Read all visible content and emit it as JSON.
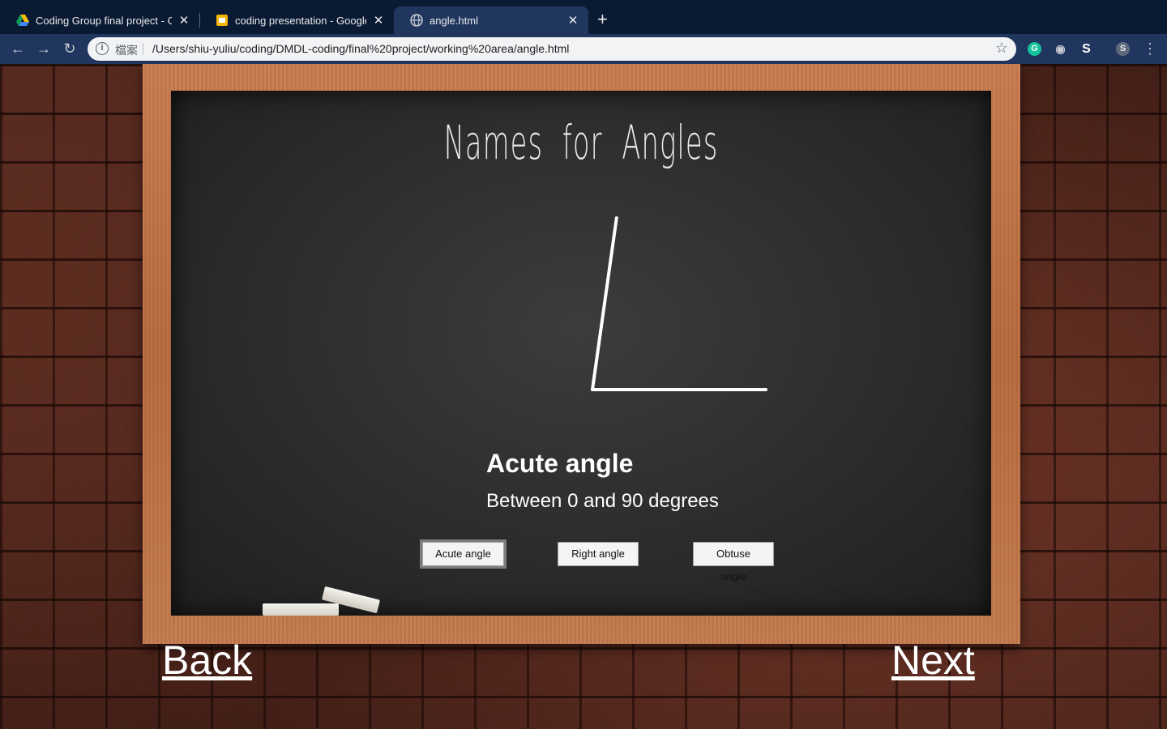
{
  "browser": {
    "tabs": [
      {
        "title": "Coding Group final project - Go",
        "favicon": "google-drive-icon"
      },
      {
        "title": "coding presentation - Google Slides",
        "favicon": "google-slides-icon"
      },
      {
        "title": "angle.html",
        "favicon": "globe-icon",
        "active": true
      }
    ],
    "scheme_label": "檔案",
    "url": "/Users/shiu-yuliu/coding/DMDL-coding/final%20project/working%20area/angle.html",
    "profile_initial": "S"
  },
  "page": {
    "title": "Names  for  Angles",
    "angle_name": "Acute angle",
    "angle_description": "Between 0 and 90 degrees",
    "angle_degrees": 82,
    "buttons": [
      "Acute angle",
      "Right angle",
      "Obtuse angle"
    ],
    "back_label": "Back",
    "next_label": "Next"
  },
  "colors": {
    "chalkboard": "#2c2c2c",
    "frame": "#c07347",
    "brick": "#6c3326",
    "chalk_text": "#ffffff"
  }
}
